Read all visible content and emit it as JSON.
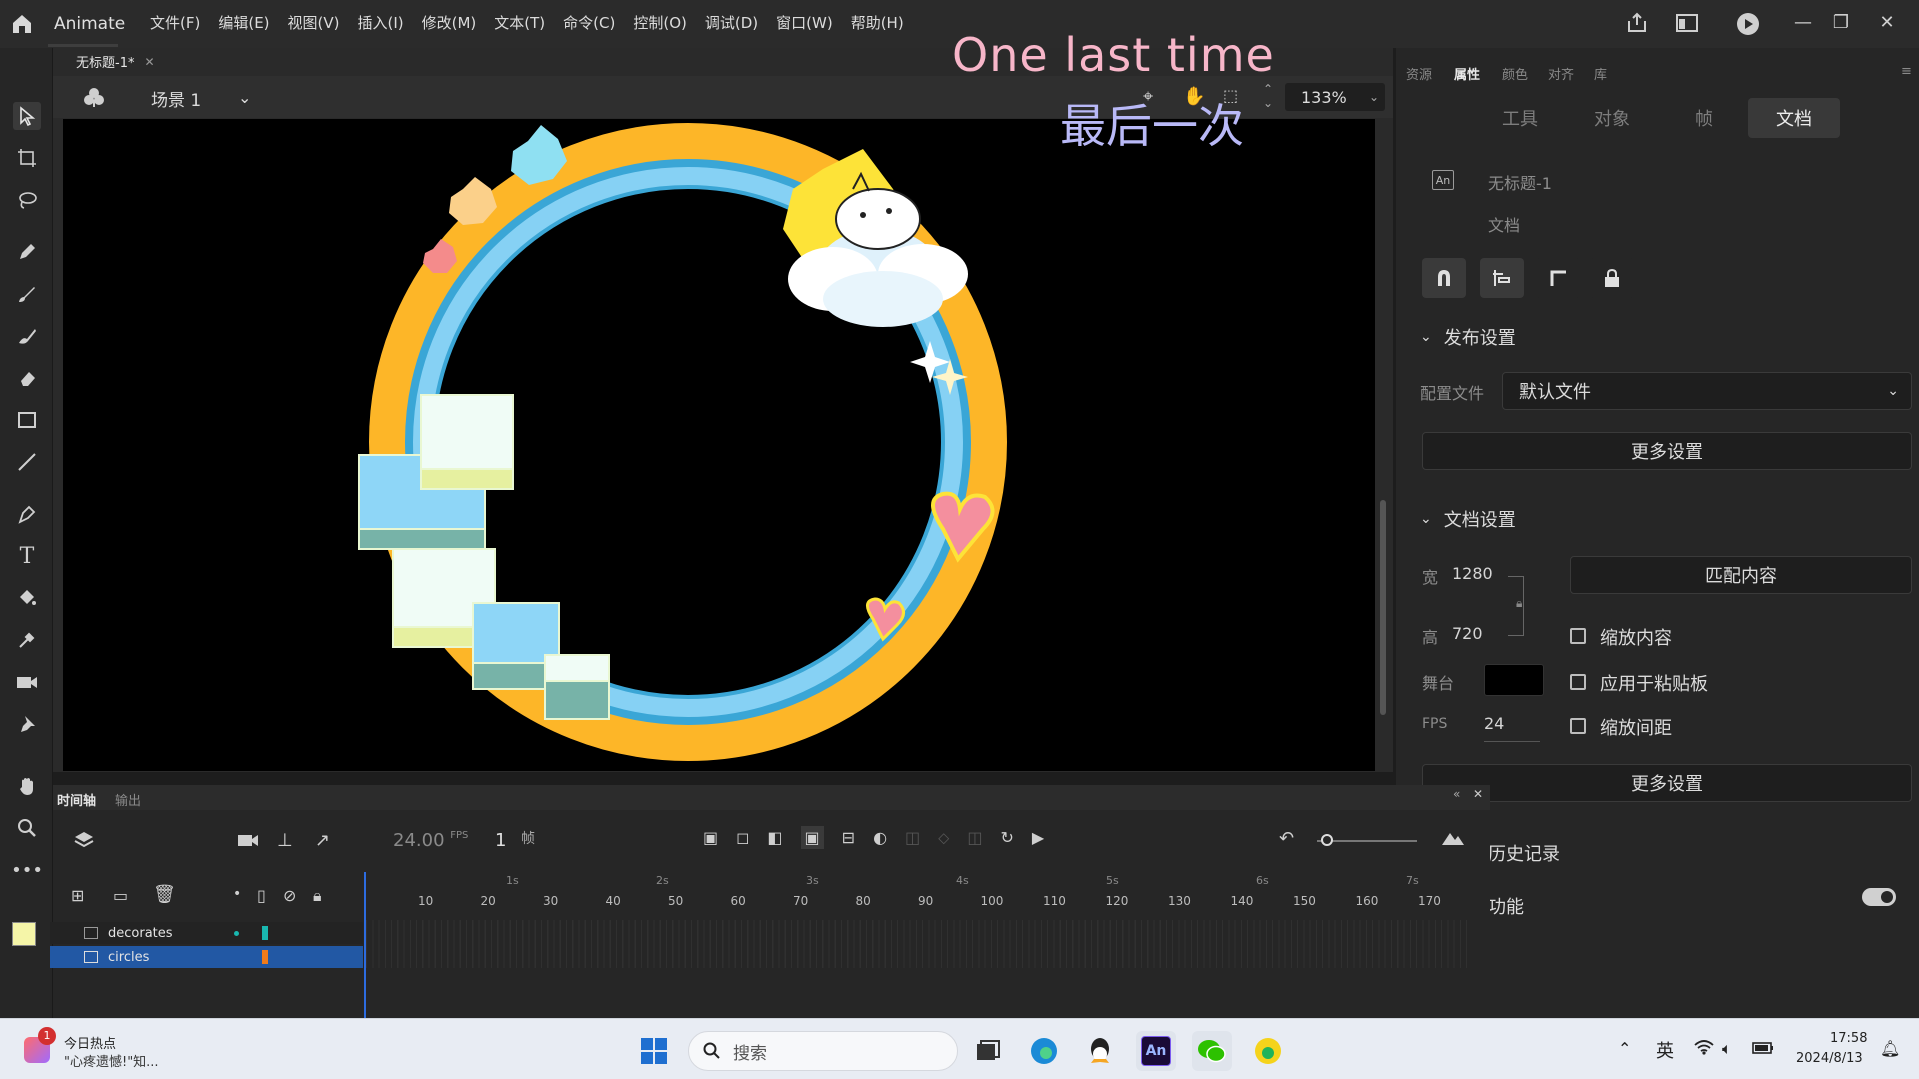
{
  "app": {
    "name": "Animate"
  },
  "menu": [
    "文件(F)",
    "编辑(E)",
    "视图(V)",
    "插入(I)",
    "修改(M)",
    "文本(T)",
    "命令(C)",
    "控制(O)",
    "调试(D)",
    "窗口(W)",
    "帮助(H)"
  ],
  "overlay": {
    "line1": "One last time",
    "line2": "最后一次"
  },
  "document": {
    "tab_title": "无标题-1*",
    "scene": "场景 1",
    "zoom": "133%"
  },
  "panel_tabs": [
    "资源",
    "属性",
    "颜色",
    "对齐",
    "库"
  ],
  "props": {
    "tabs": [
      "工具",
      "对象",
      "帧",
      "文档"
    ],
    "doc_name": "无标题-1",
    "doc_type": "文档",
    "publish": {
      "title": "发布设置",
      "profile_label": "配置文件",
      "profile_value": "默认文件",
      "more": "更多设置"
    },
    "docsettings": {
      "title": "文档设置",
      "width_label": "宽",
      "width": "1280",
      "height_label": "高",
      "height": "720",
      "stage_label": "舞台",
      "stage_color": "#000000",
      "fps_label": "FPS",
      "fps": "24",
      "match": "匹配内容",
      "scale_content": "缩放内容",
      "apply_paste": "应用于粘贴板",
      "scale_spacing": "缩放间距",
      "more": "更多设置"
    },
    "history": "历史记录",
    "features": "功能"
  },
  "timeline": {
    "tabs": [
      "时间轴",
      "输出"
    ],
    "fps": "24.00",
    "fps_unit": "FPS",
    "frame": "1",
    "frame_unit": "帧",
    "seconds": [
      "1s",
      "2s",
      "3s",
      "4s",
      "5s",
      "6s",
      "7s"
    ],
    "frame_numbers": [
      "10",
      "20",
      "30",
      "40",
      "50",
      "60",
      "70",
      "80",
      "90",
      "100",
      "110",
      "120",
      "130",
      "140",
      "150",
      "160",
      "170"
    ],
    "layers": [
      {
        "name": "decorates",
        "color": "#19b8b0"
      },
      {
        "name": "circles",
        "color": "#f07b1a"
      }
    ]
  },
  "taskbar": {
    "news_title": "今日热点",
    "news_sub": "\"心疼遗憾!\"知...",
    "news_badge": "1",
    "search": "搜索",
    "ime": "英",
    "time": "17:58",
    "date": "2024/8/13"
  }
}
